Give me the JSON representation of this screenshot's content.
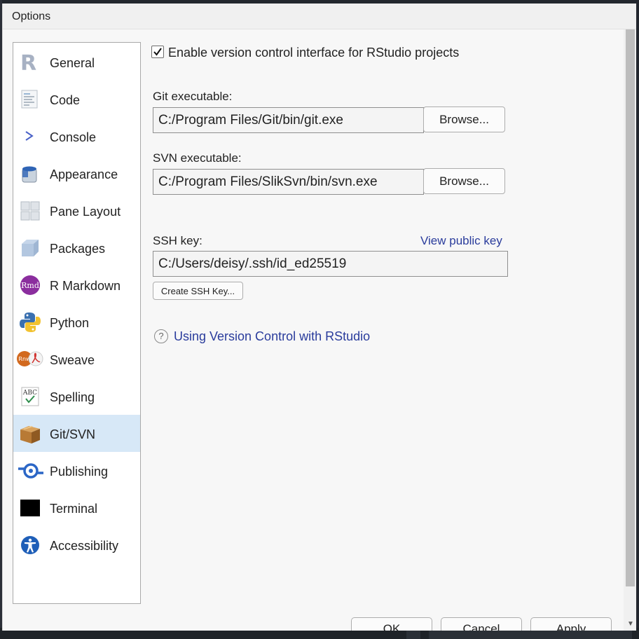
{
  "dialog": {
    "title": "Options"
  },
  "sidebar": {
    "items": [
      {
        "label": "General",
        "icon": "r-logo-icon"
      },
      {
        "label": "Code",
        "icon": "code-document-icon"
      },
      {
        "label": "Console",
        "icon": "console-prompt-icon"
      },
      {
        "label": "Appearance",
        "icon": "paint-bucket-icon"
      },
      {
        "label": "Pane Layout",
        "icon": "pane-layout-icon"
      },
      {
        "label": "Packages",
        "icon": "package-cube-icon"
      },
      {
        "label": "R Markdown",
        "icon": "rmd-icon",
        "icon_text": "Rmd"
      },
      {
        "label": "Python",
        "icon": "python-icon"
      },
      {
        "label": "Sweave",
        "icon": "sweave-icon",
        "icon_text": "Rnw"
      },
      {
        "label": "Spelling",
        "icon": "spelling-icon",
        "icon_text": "ABC"
      },
      {
        "label": "Git/SVN",
        "icon": "git-box-icon",
        "selected": true
      },
      {
        "label": "Publishing",
        "icon": "publishing-icon"
      },
      {
        "label": "Terminal",
        "icon": "terminal-icon"
      },
      {
        "label": "Accessibility",
        "icon": "accessibility-icon"
      }
    ]
  },
  "git_svn": {
    "enable_vc_label": "Enable version control interface for RStudio projects",
    "enable_vc_checked": true,
    "git_label": "Git executable:",
    "git_path": "C:/Program Files/Git/bin/git.exe",
    "git_browse": "Browse...",
    "svn_label": "SVN executable:",
    "svn_path": "C:/Program Files/SlikSvn/bin/svn.exe",
    "svn_browse": "Browse...",
    "ssh_label": "SSH key:",
    "view_public_key": "View public key",
    "ssh_path": "C:/Users/deisy/.ssh/id_ed25519",
    "create_ssh_key": "Create SSH Key...",
    "help_link": "Using Version Control with RStudio",
    "help_icon_text": "?"
  },
  "footer": {
    "ok": "OK",
    "cancel": "Cancel",
    "apply": "Apply"
  },
  "colors": {
    "selected_bg": "#d7e8f7",
    "link": "#2a3c9c"
  }
}
